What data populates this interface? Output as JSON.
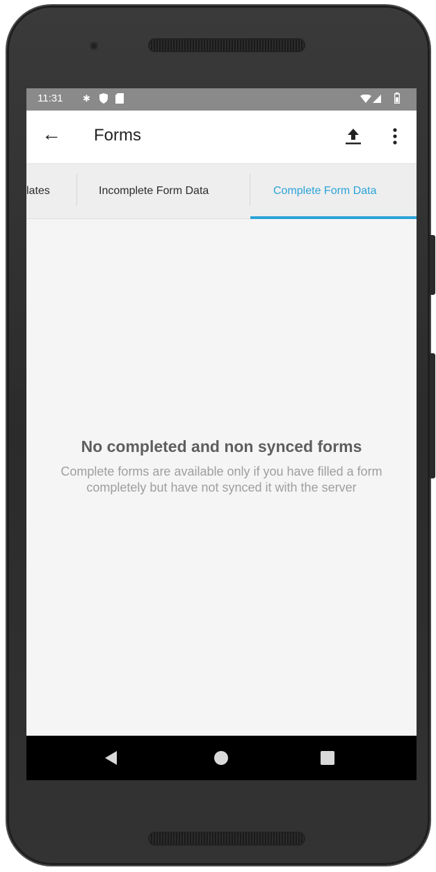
{
  "status_bar": {
    "time": "11:31",
    "icons": [
      "settings-icon",
      "shield-icon",
      "sd-card-icon",
      "wifi-icon",
      "signal-icon",
      "battery-icon"
    ]
  },
  "app_bar": {
    "title": "Forms",
    "icons": [
      "back-arrow-icon",
      "upload-icon",
      "more-vert-icon"
    ]
  },
  "tabs": [
    {
      "label": "lates",
      "active": false
    },
    {
      "label": "Incomplete Form Data",
      "active": false
    },
    {
      "label": "Complete Form Data",
      "active": true
    }
  ],
  "empty_state": {
    "title": "No completed and non synced forms",
    "description": "Complete forms are available only if you have filled a form completely but have not synced it with the server"
  },
  "nav_bar": {
    "icons": [
      "nav-back-icon",
      "nav-home-icon",
      "nav-recents-icon"
    ]
  },
  "colors": {
    "accent": "#2aa3d8",
    "status_bar": "#8a8a8a",
    "tab_background": "#eeeeee",
    "screen_background": "#f5f5f5"
  }
}
